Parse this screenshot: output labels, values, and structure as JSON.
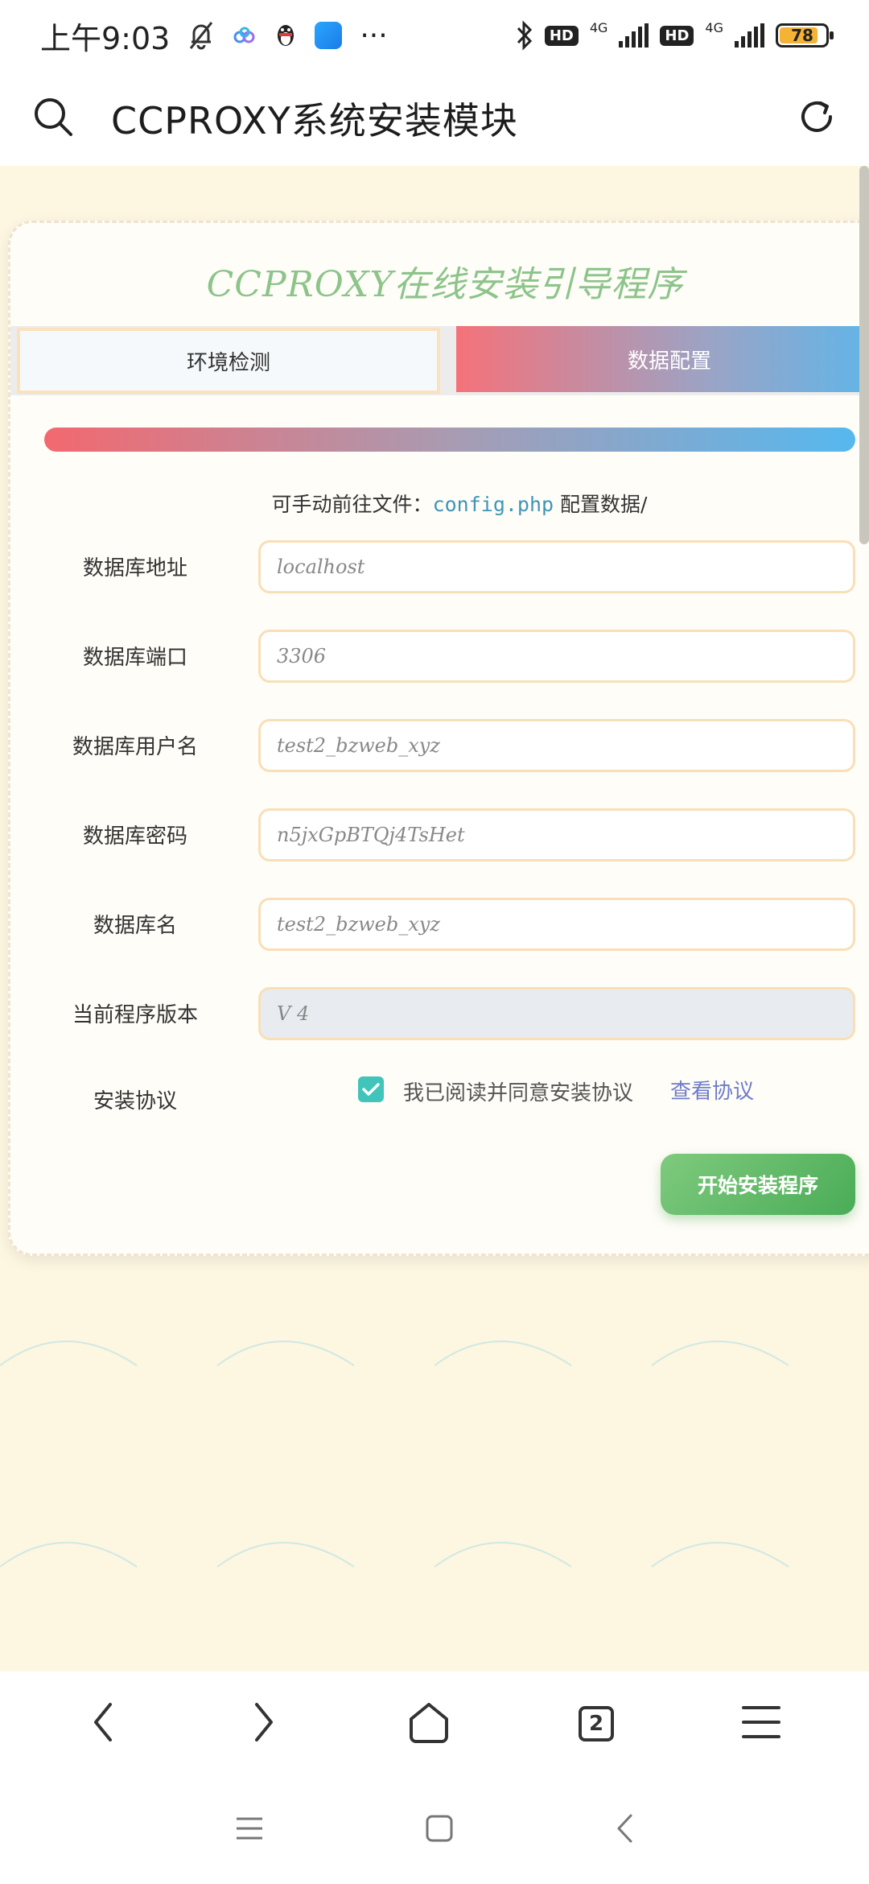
{
  "status_bar": {
    "time": "上午9:03",
    "network_1": "4G",
    "network_2": "4G",
    "hd_1": "HD",
    "hd_2": "HD",
    "battery": "78",
    "more": "···"
  },
  "browser": {
    "title": "CCPROXY系统安装模块",
    "tab_count": "2"
  },
  "installer": {
    "title": "CCPROXY在线安装引导程序",
    "tabs": [
      {
        "label": "环境检测",
        "active": false
      },
      {
        "label": "数据配置",
        "active": true
      }
    ],
    "hint_prefix": "可手动前往文件：",
    "hint_file": "config.php",
    "hint_suffix": " 配置数据/",
    "fields": [
      {
        "label": "数据库地址",
        "value": "localhost"
      },
      {
        "label": "数据库端口",
        "value": "3306"
      },
      {
        "label": "数据库用户名",
        "value": "test2_bzweb_xyz"
      },
      {
        "label": "数据库密码",
        "value": "n5jxGpBTQj4TsHet"
      },
      {
        "label": "数据库名",
        "value": "test2_bzweb_xyz"
      },
      {
        "label": "当前程序版本",
        "value": "V 4",
        "disabled": true
      }
    ],
    "agreement": {
      "label": "安装协议",
      "checkbox_text": "我已阅读并同意安装协议",
      "checked": true,
      "link": "查看协议"
    },
    "install_button": "开始安装程序"
  },
  "colors": {
    "page_bg": "#fdf6e1",
    "title_green": "#8cc48a",
    "button_green": "#4aac57",
    "checkbox": "#41c4ba",
    "link": "#6e7cc9"
  }
}
